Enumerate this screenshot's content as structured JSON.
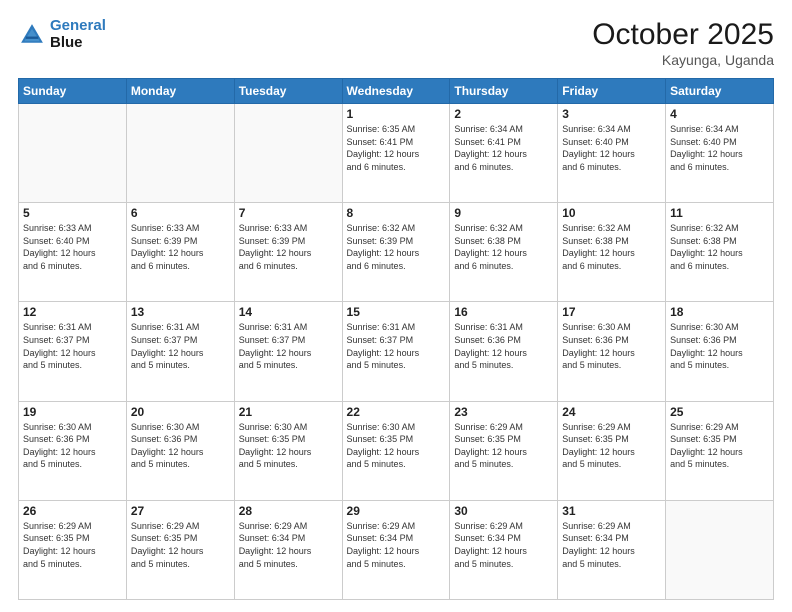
{
  "header": {
    "logo_line1": "General",
    "logo_line2": "Blue",
    "month": "October 2025",
    "location": "Kayunga, Uganda"
  },
  "days_of_week": [
    "Sunday",
    "Monday",
    "Tuesday",
    "Wednesday",
    "Thursday",
    "Friday",
    "Saturday"
  ],
  "weeks": [
    [
      {
        "day": "",
        "info": ""
      },
      {
        "day": "",
        "info": ""
      },
      {
        "day": "",
        "info": ""
      },
      {
        "day": "1",
        "info": "Sunrise: 6:35 AM\nSunset: 6:41 PM\nDaylight: 12 hours\nand 6 minutes."
      },
      {
        "day": "2",
        "info": "Sunrise: 6:34 AM\nSunset: 6:41 PM\nDaylight: 12 hours\nand 6 minutes."
      },
      {
        "day": "3",
        "info": "Sunrise: 6:34 AM\nSunset: 6:40 PM\nDaylight: 12 hours\nand 6 minutes."
      },
      {
        "day": "4",
        "info": "Sunrise: 6:34 AM\nSunset: 6:40 PM\nDaylight: 12 hours\nand 6 minutes."
      }
    ],
    [
      {
        "day": "5",
        "info": "Sunrise: 6:33 AM\nSunset: 6:40 PM\nDaylight: 12 hours\nand 6 minutes."
      },
      {
        "day": "6",
        "info": "Sunrise: 6:33 AM\nSunset: 6:39 PM\nDaylight: 12 hours\nand 6 minutes."
      },
      {
        "day": "7",
        "info": "Sunrise: 6:33 AM\nSunset: 6:39 PM\nDaylight: 12 hours\nand 6 minutes."
      },
      {
        "day": "8",
        "info": "Sunrise: 6:32 AM\nSunset: 6:39 PM\nDaylight: 12 hours\nand 6 minutes."
      },
      {
        "day": "9",
        "info": "Sunrise: 6:32 AM\nSunset: 6:38 PM\nDaylight: 12 hours\nand 6 minutes."
      },
      {
        "day": "10",
        "info": "Sunrise: 6:32 AM\nSunset: 6:38 PM\nDaylight: 12 hours\nand 6 minutes."
      },
      {
        "day": "11",
        "info": "Sunrise: 6:32 AM\nSunset: 6:38 PM\nDaylight: 12 hours\nand 6 minutes."
      }
    ],
    [
      {
        "day": "12",
        "info": "Sunrise: 6:31 AM\nSunset: 6:37 PM\nDaylight: 12 hours\nand 5 minutes."
      },
      {
        "day": "13",
        "info": "Sunrise: 6:31 AM\nSunset: 6:37 PM\nDaylight: 12 hours\nand 5 minutes."
      },
      {
        "day": "14",
        "info": "Sunrise: 6:31 AM\nSunset: 6:37 PM\nDaylight: 12 hours\nand 5 minutes."
      },
      {
        "day": "15",
        "info": "Sunrise: 6:31 AM\nSunset: 6:37 PM\nDaylight: 12 hours\nand 5 minutes."
      },
      {
        "day": "16",
        "info": "Sunrise: 6:31 AM\nSunset: 6:36 PM\nDaylight: 12 hours\nand 5 minutes."
      },
      {
        "day": "17",
        "info": "Sunrise: 6:30 AM\nSunset: 6:36 PM\nDaylight: 12 hours\nand 5 minutes."
      },
      {
        "day": "18",
        "info": "Sunrise: 6:30 AM\nSunset: 6:36 PM\nDaylight: 12 hours\nand 5 minutes."
      }
    ],
    [
      {
        "day": "19",
        "info": "Sunrise: 6:30 AM\nSunset: 6:36 PM\nDaylight: 12 hours\nand 5 minutes."
      },
      {
        "day": "20",
        "info": "Sunrise: 6:30 AM\nSunset: 6:36 PM\nDaylight: 12 hours\nand 5 minutes."
      },
      {
        "day": "21",
        "info": "Sunrise: 6:30 AM\nSunset: 6:35 PM\nDaylight: 12 hours\nand 5 minutes."
      },
      {
        "day": "22",
        "info": "Sunrise: 6:30 AM\nSunset: 6:35 PM\nDaylight: 12 hours\nand 5 minutes."
      },
      {
        "day": "23",
        "info": "Sunrise: 6:29 AM\nSunset: 6:35 PM\nDaylight: 12 hours\nand 5 minutes."
      },
      {
        "day": "24",
        "info": "Sunrise: 6:29 AM\nSunset: 6:35 PM\nDaylight: 12 hours\nand 5 minutes."
      },
      {
        "day": "25",
        "info": "Sunrise: 6:29 AM\nSunset: 6:35 PM\nDaylight: 12 hours\nand 5 minutes."
      }
    ],
    [
      {
        "day": "26",
        "info": "Sunrise: 6:29 AM\nSunset: 6:35 PM\nDaylight: 12 hours\nand 5 minutes."
      },
      {
        "day": "27",
        "info": "Sunrise: 6:29 AM\nSunset: 6:35 PM\nDaylight: 12 hours\nand 5 minutes."
      },
      {
        "day": "28",
        "info": "Sunrise: 6:29 AM\nSunset: 6:34 PM\nDaylight: 12 hours\nand 5 minutes."
      },
      {
        "day": "29",
        "info": "Sunrise: 6:29 AM\nSunset: 6:34 PM\nDaylight: 12 hours\nand 5 minutes."
      },
      {
        "day": "30",
        "info": "Sunrise: 6:29 AM\nSunset: 6:34 PM\nDaylight: 12 hours\nand 5 minutes."
      },
      {
        "day": "31",
        "info": "Sunrise: 6:29 AM\nSunset: 6:34 PM\nDaylight: 12 hours\nand 5 minutes."
      },
      {
        "day": "",
        "info": ""
      }
    ]
  ]
}
